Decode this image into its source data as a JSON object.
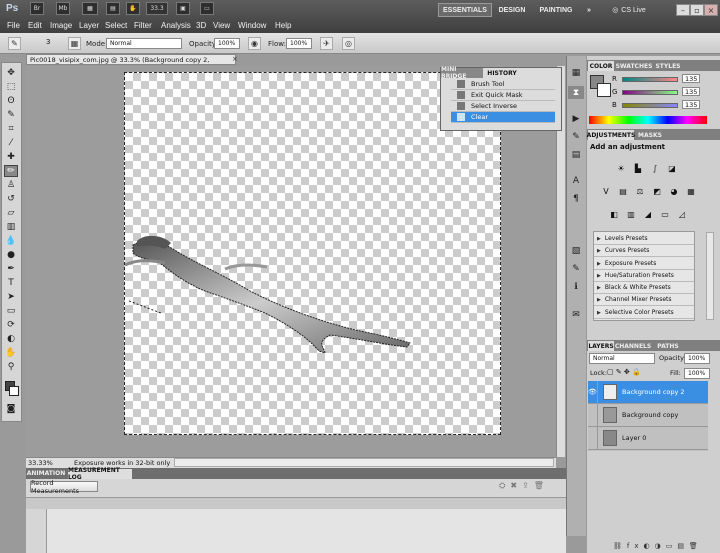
{
  "app": {
    "logo": "Ps",
    "br": "Br",
    "mb": "Mb",
    "zoom_field": "33.3"
  },
  "workspaces": [
    "ESSENTIALS",
    "DESIGN",
    "PAINTING"
  ],
  "more_ws": "»",
  "cslive": "CS Live",
  "menu": [
    "File",
    "Edit",
    "Image",
    "Layer",
    "Select",
    "Filter",
    "Analysis",
    "3D",
    "View",
    "Window",
    "Help"
  ],
  "options": {
    "brush_size": "3",
    "mode_label": "Mode:",
    "mode_value": "Normal",
    "opacity_label": "Opacity:",
    "opacity_value": "100%",
    "flow_label": "Flow:",
    "flow_value": "100%"
  },
  "document": {
    "tab_title": "Pic0018_visipix_com.jpg @ 33.3% (Background copy 2, RGB/8#) *",
    "close": "×",
    "zoom": "33.33%",
    "status": "Exposure works in 32-bit only"
  },
  "history": {
    "tabs": [
      "MINI BRIDGE",
      "HISTORY"
    ],
    "items": [
      "Brush Tool",
      "Exit Quick Mask",
      "Select Inverse",
      "Clear"
    ]
  },
  "color": {
    "tabs": [
      "COLOR",
      "SWATCHES",
      "STYLES"
    ],
    "channels": [
      {
        "label": "R",
        "value": "135"
      },
      {
        "label": "G",
        "value": "135"
      },
      {
        "label": "B",
        "value": "135"
      }
    ]
  },
  "adjustments": {
    "tabs": [
      "ADJUSTMENTS",
      "MASKS"
    ],
    "header": "Add an adjustment",
    "presets": [
      "Levels Presets",
      "Curves Presets",
      "Exposure Presets",
      "Hue/Saturation Presets",
      "Black & White Presets",
      "Channel Mixer Presets",
      "Selective Color Presets"
    ]
  },
  "layers": {
    "tabs": [
      "LAYERS",
      "CHANNELS",
      "PATHS"
    ],
    "blend": "Normal",
    "opacity_label": "Opacity:",
    "opacity_value": "100%",
    "lock_label": "Lock:",
    "fill_label": "Fill:",
    "fill_value": "100%",
    "items": [
      "Background copy 2",
      "Background copy",
      "Layer 0"
    ]
  },
  "bottom": {
    "tabs": [
      "ANIMATION",
      "MEASUREMENT LOG"
    ],
    "record_button": "Record Measurements"
  },
  "colors": {
    "accent": "#3a8fe2",
    "topbar": "#4a4a4a",
    "panel": "#cfcfcf"
  }
}
